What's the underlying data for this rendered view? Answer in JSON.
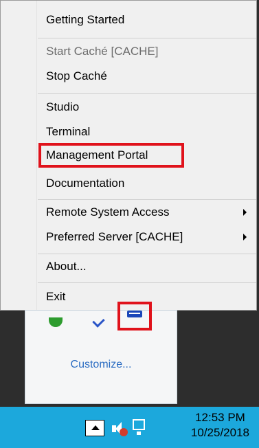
{
  "menu": {
    "items": [
      {
        "label": "Getting Started"
      },
      {
        "label": "Start Caché [CACHE]",
        "disabled": true
      },
      {
        "label": "Stop Caché"
      },
      {
        "label": "Studio"
      },
      {
        "label": "Terminal"
      },
      {
        "label": "Management Portal"
      },
      {
        "label": "Documentation"
      },
      {
        "label": "Remote System Access",
        "submenu": true
      },
      {
        "label": "Preferred Server [CACHE]",
        "submenu": true
      },
      {
        "label": "About..."
      },
      {
        "label": "Exit"
      }
    ]
  },
  "tray_panel": {
    "customize_label": "Customize...",
    "icons": [
      "security-shield-icon",
      "check-icon",
      "cache-cube-icon"
    ]
  },
  "taskbar": {
    "time": "12:53 PM",
    "date": "10/25/2018",
    "icons": [
      "show-hidden-icons-icon",
      "speaker-muted-icon",
      "network-icon"
    ]
  },
  "colors": {
    "taskbar": "#1ca8dc",
    "highlight": "#e0121b",
    "link": "#2a6cc2"
  }
}
